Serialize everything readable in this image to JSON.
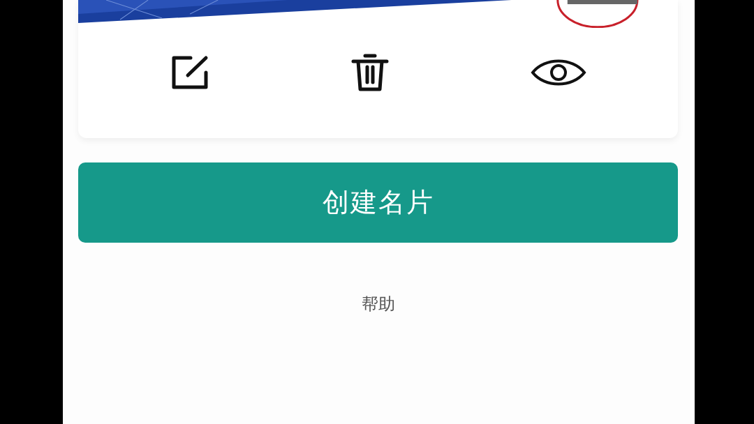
{
  "card": {
    "actions": [
      {
        "kind": "edit"
      },
      {
        "kind": "delete"
      },
      {
        "kind": "preview"
      }
    ]
  },
  "create_button": "创建名片",
  "help_link": "帮助"
}
